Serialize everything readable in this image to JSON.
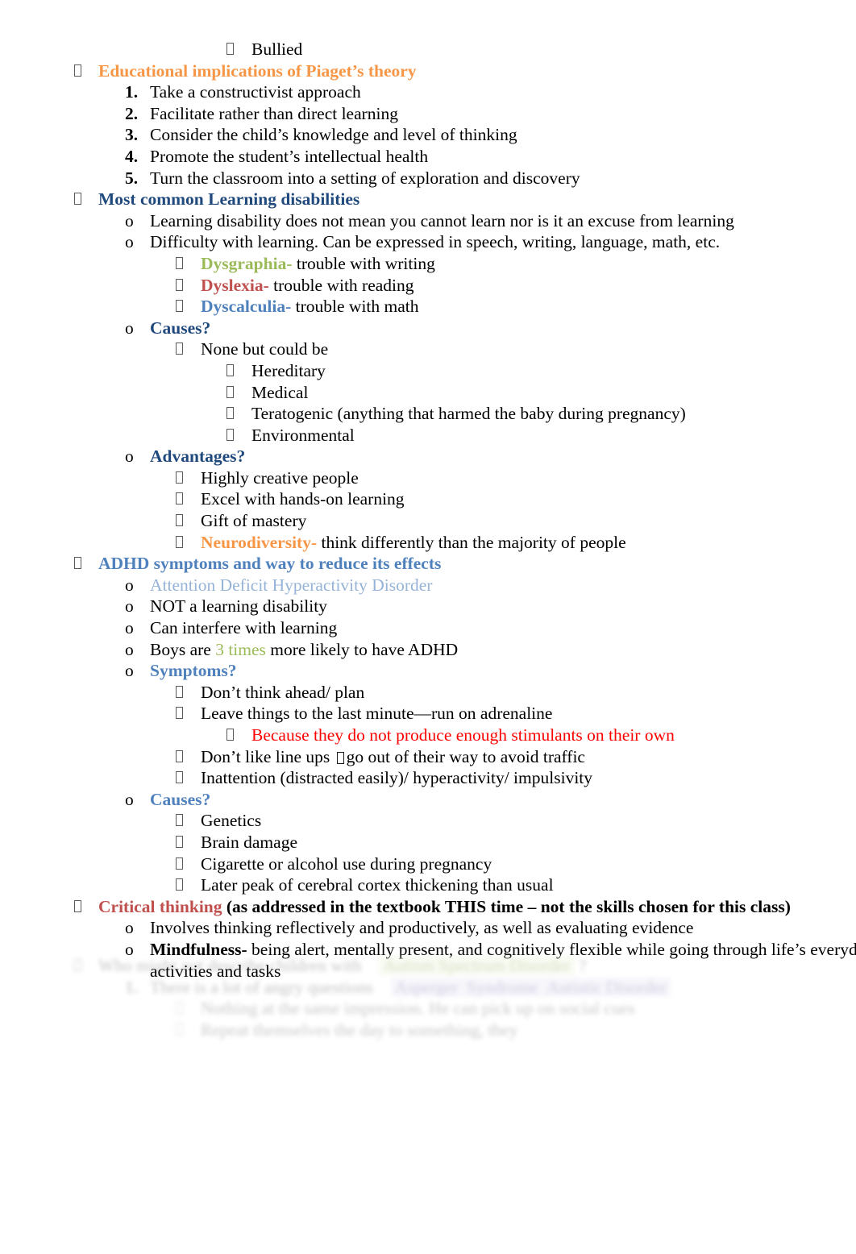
{
  "document": {
    "background_color": "#ffffff",
    "colors": {
      "orange": "#F79646",
      "navy": "#1F497D",
      "blue": "#4F81BD",
      "light_blue": "#95B3D7",
      "olive_green": "#9BBB59",
      "brick_red": "#C0504D",
      "bright_red": "#FF0000",
      "black": "#000000"
    },
    "lines": {
      "bullied": "Bullied",
      "piaget_heading": "Educational implications of Piaget’s theory",
      "piaget_1": "Take a constructivist approach",
      "piaget_2": "Facilitate rather than direct learning",
      "piaget_3": "Consider the child’s knowledge and level of thinking",
      "piaget_4": "Promote the student’s intellectual health",
      "piaget_5": "Turn the classroom into a setting of exploration and discovery",
      "ld_heading": "Most common Learning disabilities",
      "ld_1": "Learning disability does not mean you cannot learn nor is it an excuse from learning",
      "ld_2": "Difficulty with learning. Can be expressed in speech, writing, language, math, etc.",
      "dysgraphia_term": "Dysgraphia-",
      "dysgraphia_def": " trouble with writing",
      "dyslexia_term": "Dyslexia-",
      "dyslexia_def": " trouble with reading",
      "dyscalculia_term": "Dyscalculia-",
      "dyscalculia_def": " trouble with math",
      "ld_causes_heading": "Causes?",
      "ld_causes_none": "None but could be",
      "ld_cause_hereditary": "Hereditary",
      "ld_cause_medical": "Medical",
      "ld_cause_teratogenic": "Teratogenic (anything that harmed the baby during pregnancy)",
      "ld_cause_environmental": "Environmental",
      "ld_advantages_heading": "Advantages?",
      "adv_1": "Highly creative people",
      "adv_2": "Excel with hands-on learning",
      "adv_3": "Gift of mastery",
      "neurodiversity_term": "Neurodiversity-",
      "neurodiversity_def": " think differently than the majority of people",
      "adhd_heading": "ADHD symptoms and way to reduce its effects",
      "adhd_expansion": "Attention Deficit Hyperactivity Disorder",
      "adhd_not_ld": "NOT a learning disability",
      "adhd_interfere": "Can interfere with learning",
      "adhd_boys_pre": "Boys are ",
      "adhd_boys_count": "3 times",
      "adhd_boys_post": " more likely to have ADHD",
      "adhd_symptoms_heading": "Symptoms?",
      "sym_1": "Don’t think ahead/ plan",
      "sym_2": "Leave things to the last minute—run on adrenaline",
      "sym_2_sub": "Because they do not produce enough stimulants on their own",
      "sym_3_pre": "Don’t like line ups ",
      "sym_3_post": "go out of their way to avoid traffic",
      "sym_4": "Inattention (distracted easily)/ hyperactivity/ impulsivity",
      "adhd_causes_heading": "Causes?",
      "adhd_cause_genetics": "Genetics",
      "adhd_cause_brain_damage": "Brain damage",
      "adhd_cause_cigarette": "Cigarette or alcohol use during pregnancy",
      "adhd_cause_cortex": "Later peak of cerebral cortex thickening than usual",
      "critical_thinking_term": "Critical thinking",
      "critical_thinking_rest": " (as addressed in the textbook THIS time – not the skills chosen for this class)",
      "ct_1": "Involves thinking reflectively and productively, as well as evaluating evidence",
      "mindfulness_term": "Mindfulness-",
      "mindfulness_def": " being alert, mentally present, and cognitively flexible while going through life’s everyday activities and tasks"
    },
    "markers": {
      "square_bullet": "square-bullet-glyph-box",
      "o_bullet": "o",
      "num_1": "1.",
      "num_2": "2.",
      "num_3": "3.",
      "num_4": "4.",
      "num_5": "5."
    }
  }
}
